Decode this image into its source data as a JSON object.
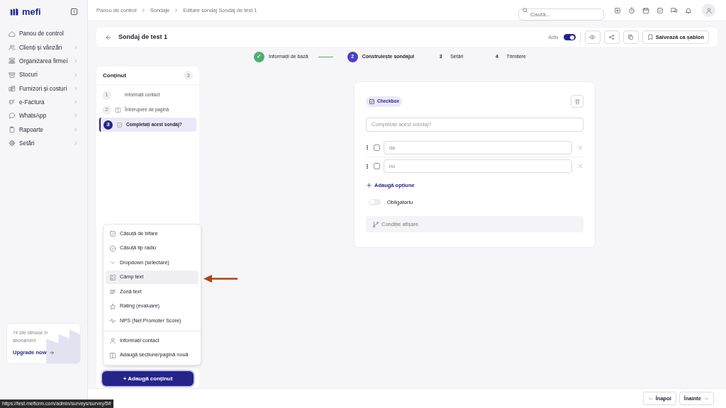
{
  "brand": {
    "name": "mefi"
  },
  "sidebar": {
    "items": [
      {
        "label": "Panou de control",
        "has_submenu": false
      },
      {
        "label": "Clienți și vânzări",
        "has_submenu": true
      },
      {
        "label": "Organizarea firmei",
        "has_submenu": true
      },
      {
        "label": "Stocuri",
        "has_submenu": true
      },
      {
        "label": "Furnizori și costuri",
        "has_submenu": true
      },
      {
        "label": "e-Factura",
        "has_submenu": true
      },
      {
        "label": "WhatsApp",
        "has_submenu": true
      },
      {
        "label": "Rapoarte",
        "has_submenu": true
      },
      {
        "label": "Setări",
        "has_submenu": true
      }
    ],
    "upgrade": {
      "text": "74 zile rămase în abonament",
      "link": "Upgrade now"
    }
  },
  "breadcrumbs": [
    "Panou de control",
    "Sondaje",
    "Editare sondaj Sondaj de test 1"
  ],
  "search": {
    "placeholder": "Caută..."
  },
  "header": {
    "title": "Sondaj de test 1",
    "active_label": "Activ",
    "active": true,
    "save_template": "Salvează ca șablon"
  },
  "steps": [
    {
      "number": "✓",
      "label": "Informații de bază",
      "completed": true,
      "current": false
    },
    {
      "number": "2",
      "label": "Construiește sondajul",
      "completed": false,
      "current": true
    },
    {
      "number": "3",
      "label": "Setări",
      "completed": false,
      "current": false
    },
    {
      "number": "4",
      "label": "Trimitere",
      "completed": false,
      "current": false
    }
  ],
  "content_panel": {
    "title": "Conținut",
    "count": "3",
    "items": [
      {
        "number": "1",
        "label": "Informații contact",
        "kind": "contact",
        "selected": false
      },
      {
        "number": "2",
        "label": "Întrerupere de pagină",
        "kind": "page",
        "selected": false
      },
      {
        "number": "3",
        "label": "Completați acest sondaj?",
        "kind": "checkbox",
        "selected": true
      }
    ]
  },
  "add_menu": {
    "items": [
      {
        "label": "Căsuță de bifare",
        "kind": "checkbox",
        "highlighted": false
      },
      {
        "label": "Căsuță tip radio",
        "kind": "radio",
        "highlighted": false
      },
      {
        "label": "Dropdown (selectare)",
        "kind": "dropdown",
        "highlighted": false
      },
      {
        "label": "Câmp text",
        "kind": "text",
        "highlighted": true
      },
      {
        "label": "Zonă text",
        "kind": "textarea",
        "highlighted": false
      },
      {
        "label": "Rating (evaluare)",
        "kind": "rating",
        "highlighted": false
      },
      {
        "label": "NPS (Net Promoter Score)",
        "kind": "nps",
        "highlighted": false
      },
      {
        "label": "Informații contact",
        "kind": "contact",
        "highlighted": false
      },
      {
        "label": "Adaugă secțiune/pagină nouă",
        "kind": "page",
        "highlighted": false
      }
    ],
    "button": "+ Adaugă conținut"
  },
  "editor": {
    "type_badge": "Checkbox",
    "question_placeholder": "Completați acest sondaj?",
    "options": [
      {
        "value": "da",
        "checked": false
      },
      {
        "value": "nu",
        "checked": false
      }
    ],
    "add_option": "Adaugă opțiune",
    "required_label": "Obligatoriu",
    "required": false,
    "condition": "Condiție afișare"
  },
  "footer": {
    "back": "Înapoi",
    "next": "Înainte"
  },
  "status_url": "https://test.meficrm.com/admin/surveys/survey/5#"
}
